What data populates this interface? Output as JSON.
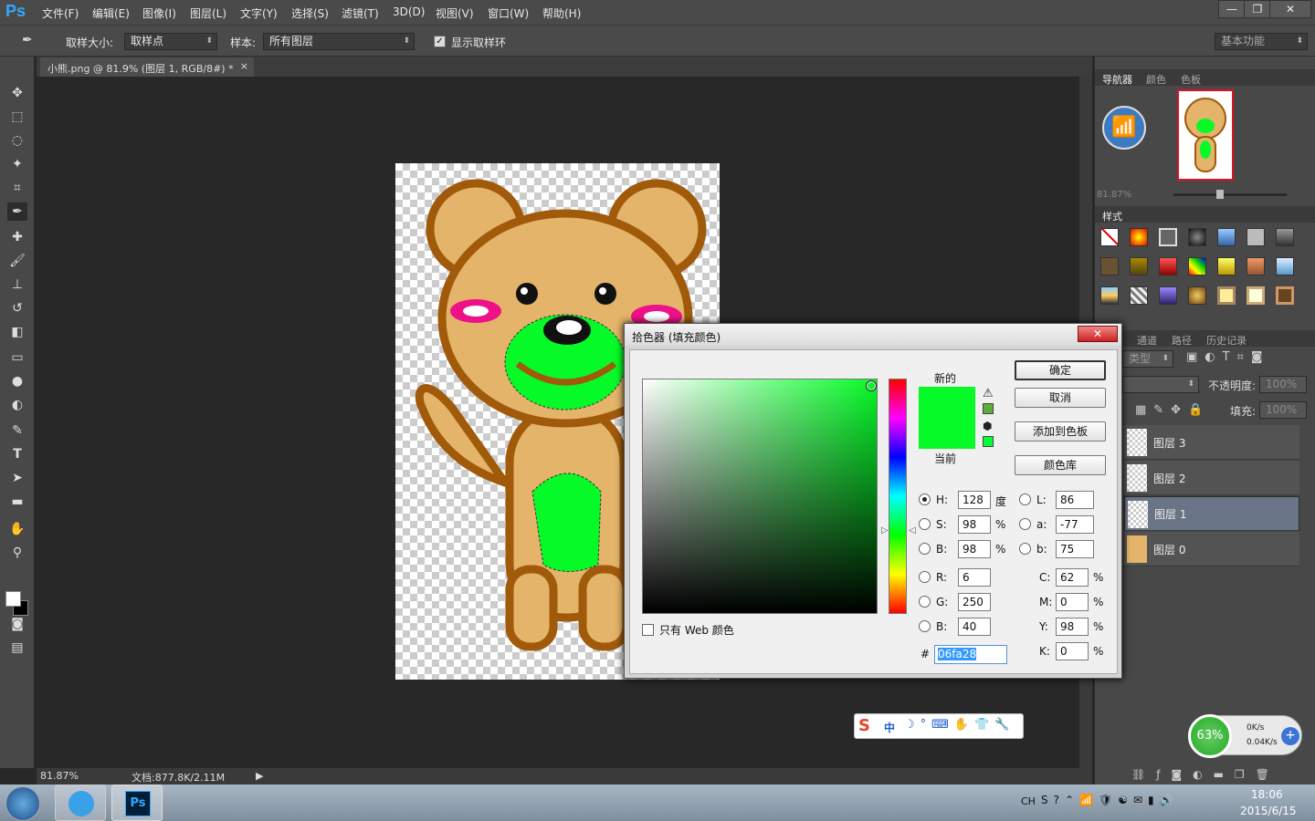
{
  "app": {
    "logo": "Ps"
  },
  "menu": [
    "文件(F)",
    "编辑(E)",
    "图像(I)",
    "图层(L)",
    "文字(Y)",
    "选择(S)",
    "滤镜(T)",
    "3D(D)",
    "视图(V)",
    "窗口(W)",
    "帮助(H)"
  ],
  "options": {
    "sample_size_label": "取样大小:",
    "sample_size_value": "取样点",
    "sample_label": "样本:",
    "sample_value": "所有图层",
    "show_ring": "显示取样环",
    "workspace": "基本功能"
  },
  "document": {
    "tab": "小熊.png @ 81.9% (图层 1, RGB/8#) *",
    "tab_close": "×"
  },
  "status": {
    "zoom": "81.87%",
    "doc": "文档:877.8K/2.11M"
  },
  "navigator": {
    "tabs": [
      "导航器",
      "颜色",
      "色板"
    ],
    "zoom": "81.87%"
  },
  "styles": {
    "title": "样式"
  },
  "layers_panel": {
    "tabs": [
      "通道",
      "路径",
      "历史记录"
    ],
    "kind": "类型",
    "opacity_label": "不透明度:",
    "opacity_value": "100%",
    "fill_label": "填充:",
    "fill_value": "100%",
    "layers": [
      "图层 3",
      "图层 2",
      "图层 1",
      "图层 0"
    ],
    "selected_index": 2
  },
  "dialog": {
    "title": "拾色器 (填充颜色)",
    "close": "✕",
    "new_label": "新的",
    "current_label": "当前",
    "buttons": {
      "ok": "确定",
      "cancel": "取消",
      "add_swatch": "添加到色板",
      "color_lib": "颜色库"
    },
    "web_only": "只有 Web 颜色",
    "hsb": {
      "H": "128",
      "S": "98",
      "B": "98",
      "H_unit": "度",
      "S_unit": "%",
      "B_unit": "%"
    },
    "rgb": {
      "R": "6",
      "G": "250",
      "B": "40"
    },
    "lab": {
      "L": "86",
      "a": "-77",
      "b": "75"
    },
    "cmyk": {
      "C": "62",
      "M": "0",
      "Y": "98",
      "K": "0",
      "unit": "%"
    },
    "hex_label": "#",
    "hex": "06fa28",
    "labels": {
      "H": "H:",
      "S": "S:",
      "Bh": "B:",
      "R": "R:",
      "G": "G:",
      "Br": "B:",
      "L": "L:",
      "a": "a:",
      "b": "b:",
      "C": "C:",
      "M": "M:",
      "Y": "Y:",
      "K": "K:"
    }
  },
  "colors": {
    "new": "#06fa28",
    "current": "#06fa28",
    "accent": "#31a8ff"
  },
  "netmon": {
    "percent": "63%",
    "up": "0K/s",
    "down": "0.04K/s"
  },
  "ime": {
    "text": "中"
  },
  "taskbar": {
    "lang": "CH",
    "time": "18:06",
    "date": "2015/6/15"
  }
}
